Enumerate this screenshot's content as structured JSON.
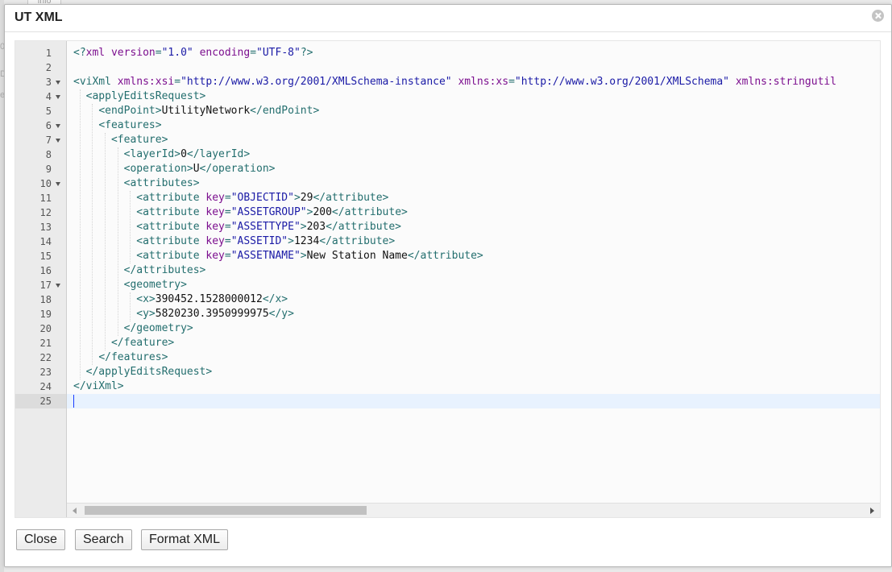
{
  "background": {
    "tab_label": "Info"
  },
  "dialog": {
    "title": "UT XML",
    "close_icon": "close-circle-icon"
  },
  "editor": {
    "active_line": 25,
    "lines": [
      {
        "n": "1",
        "fold": false,
        "tokens": [
          [
            "t",
            "<?"
          ],
          [
            "a",
            "xml"
          ],
          [
            "x",
            " "
          ],
          [
            "a",
            "version"
          ],
          [
            "t",
            "="
          ],
          [
            "s",
            "\"1.0\""
          ],
          [
            "x",
            " "
          ],
          [
            "a",
            "encoding"
          ],
          [
            "t",
            "="
          ],
          [
            "s",
            "\"UTF-8\""
          ],
          [
            "t",
            "?>"
          ]
        ]
      },
      {
        "n": "2",
        "fold": false,
        "tokens": []
      },
      {
        "n": "3",
        "fold": true,
        "tokens": [
          [
            "t",
            "<viXml "
          ],
          [
            "a",
            "xmlns:xsi"
          ],
          [
            "t",
            "="
          ],
          [
            "s",
            "\"http://www.w3.org/2001/XMLSchema-instance\""
          ],
          [
            "x",
            " "
          ],
          [
            "a",
            "xmlns:xs"
          ],
          [
            "t",
            "="
          ],
          [
            "s",
            "\"http://www.w3.org/2001/XMLSchema\""
          ],
          [
            "x",
            " "
          ],
          [
            "a",
            "xmlns:stringutil"
          ]
        ]
      },
      {
        "n": "4",
        "fold": true,
        "tokens": [
          [
            "x",
            "  "
          ],
          [
            "t",
            "<applyEditsRequest>"
          ]
        ]
      },
      {
        "n": "5",
        "fold": false,
        "tokens": [
          [
            "x",
            "    "
          ],
          [
            "t",
            "<endPoint>"
          ],
          [
            "x",
            "UtilityNetwork"
          ],
          [
            "t",
            "</endPoint>"
          ]
        ]
      },
      {
        "n": "6",
        "fold": true,
        "tokens": [
          [
            "x",
            "    "
          ],
          [
            "t",
            "<features>"
          ]
        ]
      },
      {
        "n": "7",
        "fold": true,
        "tokens": [
          [
            "x",
            "      "
          ],
          [
            "t",
            "<feature>"
          ]
        ]
      },
      {
        "n": "8",
        "fold": false,
        "tokens": [
          [
            "x",
            "        "
          ],
          [
            "t",
            "<layerId>"
          ],
          [
            "x",
            "0"
          ],
          [
            "t",
            "</layerId>"
          ]
        ]
      },
      {
        "n": "9",
        "fold": false,
        "tokens": [
          [
            "x",
            "        "
          ],
          [
            "t",
            "<operation>"
          ],
          [
            "x",
            "U"
          ],
          [
            "t",
            "</operation>"
          ]
        ]
      },
      {
        "n": "10",
        "fold": true,
        "tokens": [
          [
            "x",
            "        "
          ],
          [
            "t",
            "<attributes>"
          ]
        ]
      },
      {
        "n": "11",
        "fold": false,
        "tokens": [
          [
            "x",
            "          "
          ],
          [
            "t",
            "<attribute "
          ],
          [
            "a",
            "key"
          ],
          [
            "t",
            "="
          ],
          [
            "s",
            "\"OBJECTID\""
          ],
          [
            "t",
            ">"
          ],
          [
            "x",
            "29"
          ],
          [
            "t",
            "</attribute>"
          ]
        ]
      },
      {
        "n": "12",
        "fold": false,
        "tokens": [
          [
            "x",
            "          "
          ],
          [
            "t",
            "<attribute "
          ],
          [
            "a",
            "key"
          ],
          [
            "t",
            "="
          ],
          [
            "s",
            "\"ASSETGROUP\""
          ],
          [
            "t",
            ">"
          ],
          [
            "x",
            "200"
          ],
          [
            "t",
            "</attribute>"
          ]
        ]
      },
      {
        "n": "13",
        "fold": false,
        "tokens": [
          [
            "x",
            "          "
          ],
          [
            "t",
            "<attribute "
          ],
          [
            "a",
            "key"
          ],
          [
            "t",
            "="
          ],
          [
            "s",
            "\"ASSETTYPE\""
          ],
          [
            "t",
            ">"
          ],
          [
            "x",
            "203"
          ],
          [
            "t",
            "</attribute>"
          ]
        ]
      },
      {
        "n": "14",
        "fold": false,
        "tokens": [
          [
            "x",
            "          "
          ],
          [
            "t",
            "<attribute "
          ],
          [
            "a",
            "key"
          ],
          [
            "t",
            "="
          ],
          [
            "s",
            "\"ASSETID\""
          ],
          [
            "t",
            ">"
          ],
          [
            "x",
            "1234"
          ],
          [
            "t",
            "</attribute>"
          ]
        ]
      },
      {
        "n": "15",
        "fold": false,
        "tokens": [
          [
            "x",
            "          "
          ],
          [
            "t",
            "<attribute "
          ],
          [
            "a",
            "key"
          ],
          [
            "t",
            "="
          ],
          [
            "s",
            "\"ASSETNAME\""
          ],
          [
            "t",
            ">"
          ],
          [
            "x",
            "New Station Name"
          ],
          [
            "t",
            "</attribute>"
          ]
        ]
      },
      {
        "n": "16",
        "fold": false,
        "tokens": [
          [
            "x",
            "        "
          ],
          [
            "t",
            "</attributes>"
          ]
        ]
      },
      {
        "n": "17",
        "fold": true,
        "tokens": [
          [
            "x",
            "        "
          ],
          [
            "t",
            "<geometry>"
          ]
        ]
      },
      {
        "n": "18",
        "fold": false,
        "tokens": [
          [
            "x",
            "          "
          ],
          [
            "t",
            "<x>"
          ],
          [
            "x",
            "390452.1528000012"
          ],
          [
            "t",
            "</x>"
          ]
        ]
      },
      {
        "n": "19",
        "fold": false,
        "tokens": [
          [
            "x",
            "          "
          ],
          [
            "t",
            "<y>"
          ],
          [
            "x",
            "5820230.3950999975"
          ],
          [
            "t",
            "</y>"
          ]
        ]
      },
      {
        "n": "20",
        "fold": false,
        "tokens": [
          [
            "x",
            "        "
          ],
          [
            "t",
            "</geometry>"
          ]
        ]
      },
      {
        "n": "21",
        "fold": false,
        "tokens": [
          [
            "x",
            "      "
          ],
          [
            "t",
            "</feature>"
          ]
        ]
      },
      {
        "n": "22",
        "fold": false,
        "tokens": [
          [
            "x",
            "    "
          ],
          [
            "t",
            "</features>"
          ]
        ]
      },
      {
        "n": "23",
        "fold": false,
        "tokens": [
          [
            "x",
            "  "
          ],
          [
            "t",
            "</applyEditsRequest>"
          ]
        ]
      },
      {
        "n": "24",
        "fold": false,
        "tokens": [
          [
            "t",
            "</viXml>"
          ]
        ]
      },
      {
        "n": "25",
        "fold": false,
        "tokens": []
      }
    ],
    "colors": {
      "tag": "#236e6e",
      "attribute": "#7c0f8f",
      "string": "#1a1aa6",
      "text": "#111111",
      "active_line": "#e8f2fe"
    }
  },
  "buttons": {
    "close": "Close",
    "search": "Search",
    "format": "Format XML"
  }
}
